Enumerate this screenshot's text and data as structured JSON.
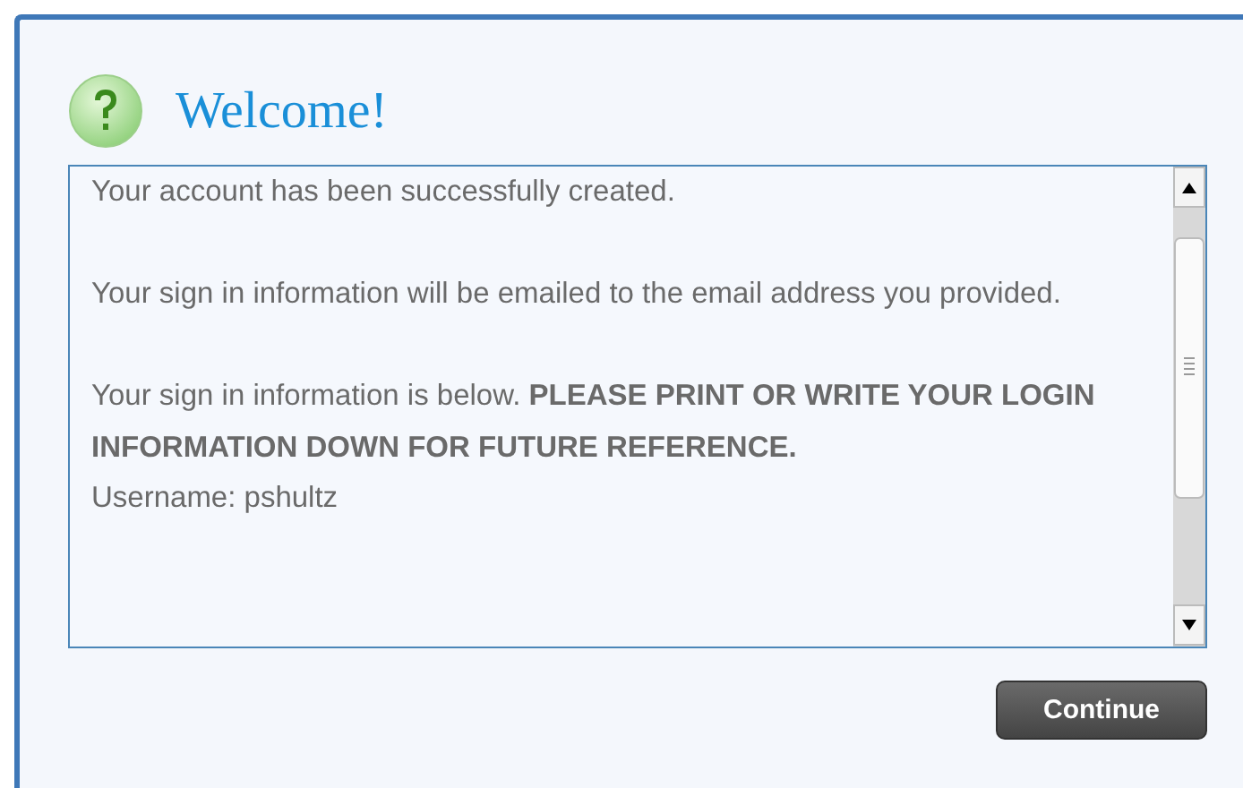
{
  "dialog": {
    "title": "Welcome!",
    "message_blocks": [
      [
        "Your account has been successfully created."
      ],
      [
        "Your sign in information will be emailed to the email address you provided."
      ],
      [
        "Your sign in information is below. **PLEASE PRINT OR WRITE YOUR LOGIN INFORMATION DOWN FOR FUTURE REFERENCE.**",
        "Username: pshultz"
      ]
    ],
    "buttons": [
      "Continue"
    ]
  }
}
